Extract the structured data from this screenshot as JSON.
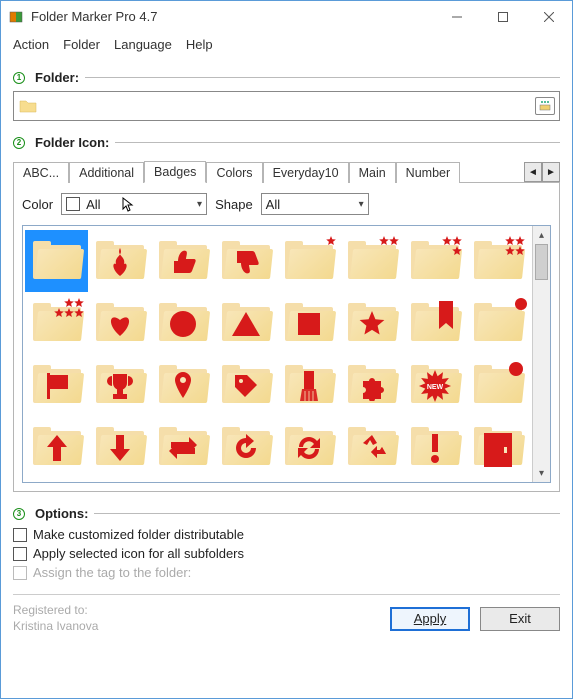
{
  "window": {
    "title": "Folder Marker Pro 4.7"
  },
  "menu": {
    "action": "Action",
    "folder": "Folder",
    "language": "Language",
    "help": "Help"
  },
  "section1": {
    "label": "Folder:"
  },
  "section2": {
    "label": "Folder Icon:"
  },
  "section3": {
    "label": "Options:"
  },
  "tabs": {
    "items": [
      "ABC...",
      "Additional",
      "Badges",
      "Colors",
      "Everyday10",
      "Main",
      "Number"
    ],
    "active": "Badges"
  },
  "filters": {
    "color_label": "Color",
    "color_value": "All",
    "shape_label": "Shape",
    "shape_value": "All"
  },
  "icons": [
    {
      "badge": "none",
      "name": "plain"
    },
    {
      "badge": "flame",
      "name": "flame"
    },
    {
      "badge": "thumbs-up",
      "name": "thumbs-up"
    },
    {
      "badge": "thumbs-down",
      "name": "thumbs-down"
    },
    {
      "badge": "star-corner-1",
      "name": "star-1"
    },
    {
      "badge": "star-corner-2",
      "name": "star-2"
    },
    {
      "badge": "star-corner-3",
      "name": "star-3"
    },
    {
      "badge": "star-corner-4",
      "name": "star-4"
    },
    {
      "badge": "star-corner-5",
      "name": "star-5"
    },
    {
      "badge": "heart",
      "name": "heart"
    },
    {
      "badge": "circle",
      "name": "circle"
    },
    {
      "badge": "triangle",
      "name": "triangle"
    },
    {
      "badge": "square",
      "name": "square"
    },
    {
      "badge": "star",
      "name": "star"
    },
    {
      "badge": "bookmark",
      "name": "bookmark"
    },
    {
      "badge": "dot-corner",
      "name": "dot"
    },
    {
      "badge": "flag",
      "name": "flag"
    },
    {
      "badge": "trophy",
      "name": "trophy"
    },
    {
      "badge": "pin",
      "name": "pin"
    },
    {
      "badge": "tag",
      "name": "tag"
    },
    {
      "badge": "brush",
      "name": "brush"
    },
    {
      "badge": "puzzle",
      "name": "puzzle"
    },
    {
      "badge": "new-burst",
      "name": "new"
    },
    {
      "badge": "dot-top",
      "name": "dot-top"
    },
    {
      "badge": "arrow-up",
      "name": "arrow-up"
    },
    {
      "badge": "arrow-down",
      "name": "arrow-down"
    },
    {
      "badge": "swap",
      "name": "swap"
    },
    {
      "badge": "redo",
      "name": "redo"
    },
    {
      "badge": "sync",
      "name": "sync"
    },
    {
      "badge": "recycle",
      "name": "recycle"
    },
    {
      "badge": "exclaim",
      "name": "exclaim"
    },
    {
      "badge": "door",
      "name": "door"
    }
  ],
  "options": {
    "opt1": "Make customized folder distributable",
    "opt2": "Apply selected icon for all subfolders",
    "opt3": "Assign the tag to the folder:"
  },
  "footer": {
    "reg_label": "Registered to:",
    "reg_name": "Kristina Ivanova",
    "apply": "Apply",
    "exit": "Exit"
  },
  "steps": {
    "one": "1",
    "two": "2",
    "three": "3"
  }
}
